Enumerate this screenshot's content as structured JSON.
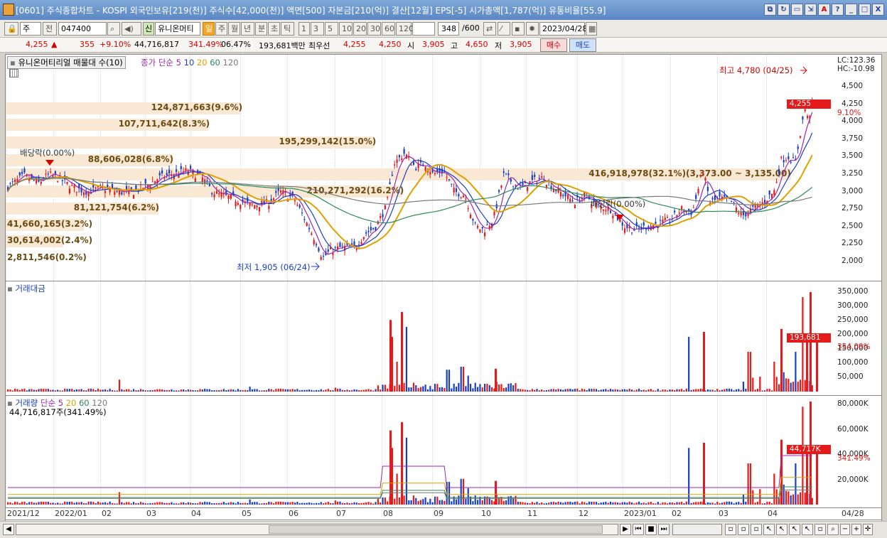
{
  "window": {
    "title": "[0601] 주식종합차트 - KOSPI 외국인보유[219(천)] 주식수[42,000(천)] 액면[500] 자본금[210(억)] 결산[12월] EPS[-5] 시가총액[1,787(억)] 유통비율[55.9]",
    "buttons": [
      "⧉",
      "↻",
      "▭",
      "⇲",
      "A",
      "?",
      "_",
      "□",
      "X"
    ]
  },
  "toolbar": {
    "market": "주",
    "type_label": "전",
    "code": "047400",
    "name": "유니온머티",
    "sin_label": "신",
    "periods": [
      "일",
      "주",
      "월",
      "년",
      "분",
      "초",
      "틱"
    ],
    "active_period": "일",
    "intervals": [
      "1",
      "3",
      "5",
      "10",
      "20",
      "30",
      "60",
      "120"
    ],
    "count": "348",
    "count_total": "/600",
    "date": "2023/04/28"
  },
  "quote": {
    "price": "4,255",
    "arrow": "▲",
    "change": "355",
    "change_pct": "+9.10%",
    "volume": "44,716,817",
    "vol_ratio": "341.49%",
    "turnover": "06.47%",
    "amount": "193,681백만",
    "priority_label": "최우선",
    "bid": "4,255",
    "ask": "4,250",
    "open_label": "시",
    "open": "3,905",
    "high_label": "고",
    "high": "4,650",
    "low_label": "저",
    "low": "3,905",
    "buy_label": "매수",
    "sell_label": "매도"
  },
  "price_pane": {
    "title": "유니온머티리얼 매물대 수(10)",
    "ma_label": "종가 단순",
    "ma": [
      "5",
      "10",
      "20",
      "60",
      "120"
    ],
    "lc": "LC:123.36",
    "hc": "HC:-10.98",
    "y_ticks": [
      "4,500",
      "4,250",
      "4,000",
      "3,750",
      "3,500",
      "3,250",
      "3,000",
      "2,750",
      "2,500",
      "2,250",
      "2,000"
    ],
    "price_tag": "4,255",
    "price_pct": "9.10%",
    "max_label": "최고 4,780 (04/25)",
    "min_label": "최저 1,905 (06/24)",
    "div_label1": "배당락(0.00%)",
    "div_label2": "배당락(0.00%)",
    "volume_profile": [
      "124,871,663(9.6%)",
      "107,711,642(8.3%)",
      "195,299,142(15.0%)",
      "88,606,028(6.8%)",
      "416,918,978(32.1%)(3,373.00 ~ 3,135.00)",
      "210,271,292(16.2%)",
      "81,121,754(6.2%)",
      "41,660,165(3.2%)",
      "30,614,002(2.4%)",
      "2,811,546(0.2%)"
    ],
    "volume_profile_values": [
      124871663,
      107711642,
      195299142,
      88606028,
      416918978,
      210271292,
      81121754,
      41660165,
      30614002,
      2811546
    ]
  },
  "amount_pane": {
    "title": "거래대금",
    "y_ticks": [
      "350,000",
      "300,000",
      "250,000",
      "200,000",
      "150,000",
      "100,000",
      "50,000"
    ],
    "tag": "193,681",
    "pct": "354.09%"
  },
  "volume_pane": {
    "title": "거래량",
    "ma_label": "단순",
    "ma": [
      "5",
      "20",
      "60",
      "120"
    ],
    "info": "44,716,817주(341.49%)",
    "y_ticks": [
      "80,000K",
      "60,000K",
      "40,000K",
      "20,000K"
    ],
    "tag": "44,717K",
    "pct": "341.49%"
  },
  "x_axis": {
    "labels": [
      "2021/12",
      "2022/01",
      "02",
      "03",
      "04",
      "05",
      "06",
      "07",
      "08",
      "09",
      "10",
      "11",
      "12",
      "2023/01",
      "02",
      "03",
      "04"
    ],
    "end_label": "04/28"
  },
  "colors": {
    "up": "#e51a1a",
    "down": "#1a3fc4",
    "ma5": "#9c27b0",
    "ma10": "#1a3fc4",
    "ma20": "#e0a000",
    "ma60": "#2e8b57",
    "ma120": "#7a7a7a",
    "band": "#f8e8d4"
  },
  "scrollbar": {
    "left": "◀",
    "right": "▶"
  }
}
